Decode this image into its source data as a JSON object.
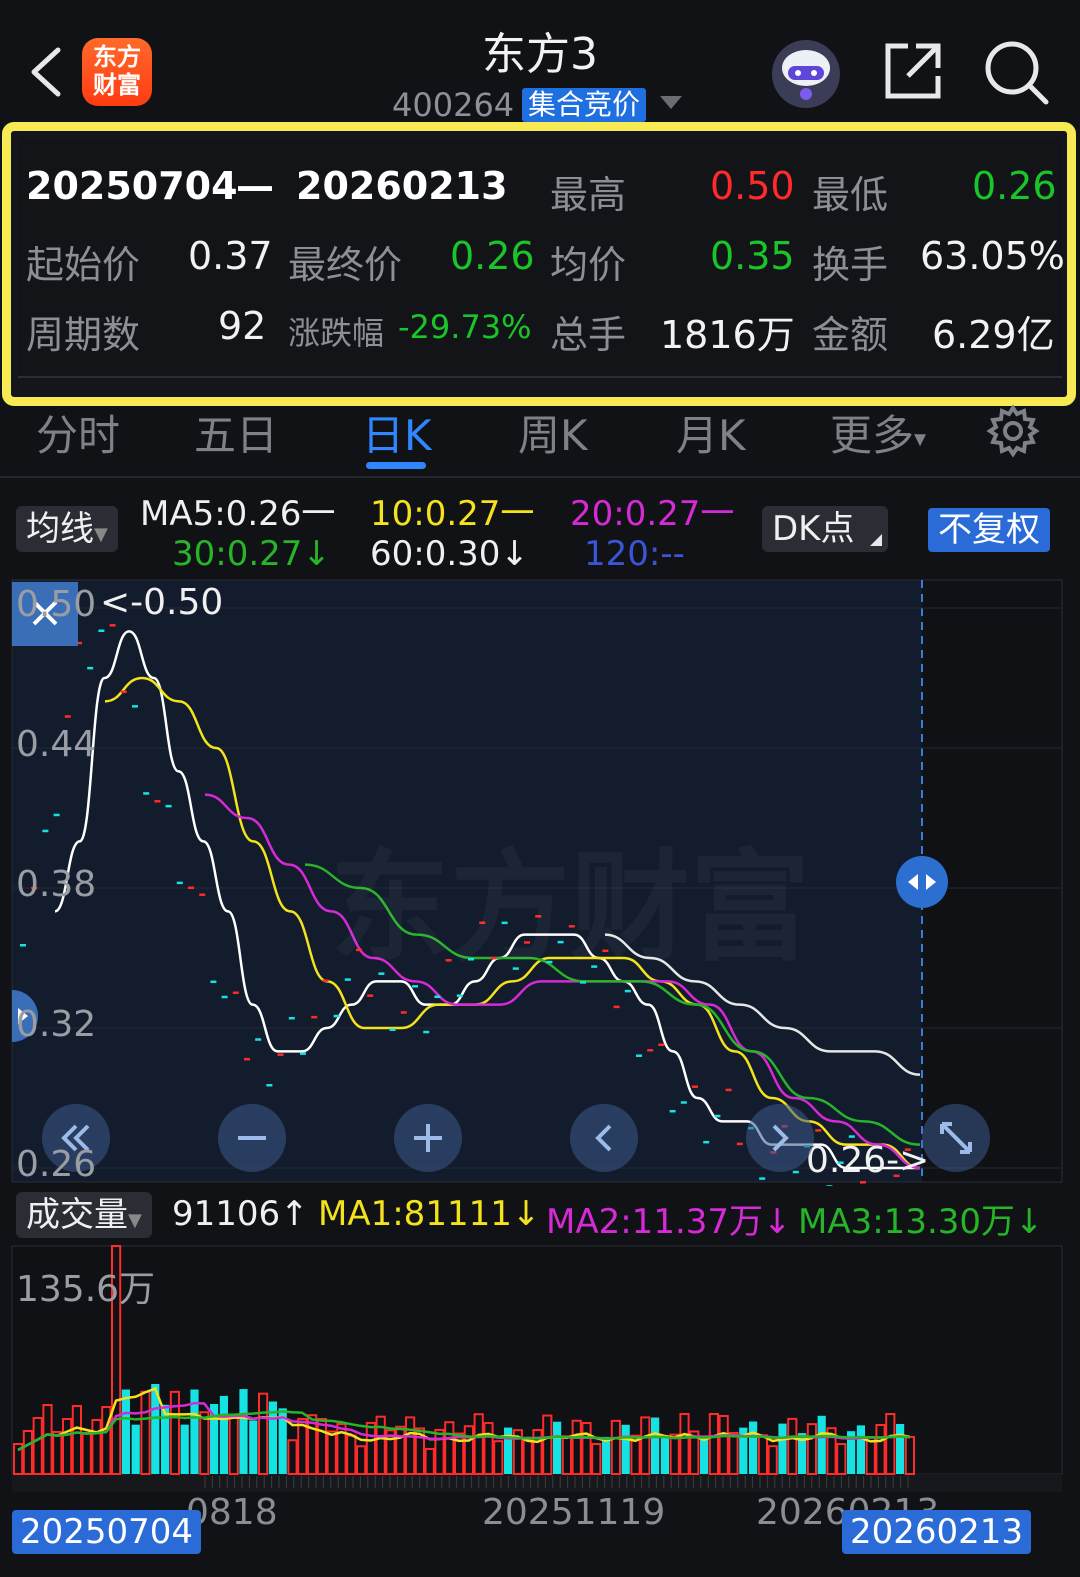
{
  "header": {
    "title": "东方3",
    "code": "400264",
    "badge": "集合竞价",
    "logo_lines": [
      "东方",
      "财富"
    ]
  },
  "stats": {
    "range_start": "20250704",
    "range_sep": "—",
    "range_end": "20260213",
    "high_label": "最高",
    "high_value": "0.50",
    "low_label": "最低",
    "low_value": "0.26",
    "open_label": "起始价",
    "open_value": "0.37",
    "close_label": "最终价",
    "close_value": "0.26",
    "avg_label": "均价",
    "avg_value": "0.35",
    "turnover_label": "换手",
    "turnover_value": "63.05%",
    "periods_label": "周期数",
    "periods_value": "92",
    "change_label": "涨跌幅",
    "change_value": "-29.73%",
    "volume_label": "总手",
    "volume_value": "1816万",
    "amount_label": "金额",
    "amount_value": "6.29亿"
  },
  "tabs": [
    "分时",
    "五日",
    "日K",
    "周K",
    "月K",
    "更多"
  ],
  "tab_more_caret": "▾",
  "ma_legend": {
    "selector": "均线",
    "ma5": "MA5:0.26一",
    "ma10": "10:0.27一",
    "ma20": "20:0.27一",
    "ma30": "30:0.27↓",
    "ma60": "60:0.30↓",
    "ma120": "120:--",
    "dk": "DK点",
    "adjust": "不复权"
  },
  "price_chart": {
    "y_ticks": [
      "0.50",
      "0.44",
      "0.38",
      "0.32",
      "0.26"
    ],
    "high_marker": "<-0.50",
    "low_marker": "0.26->",
    "watermark": "东方财富"
  },
  "volume_legend": {
    "selector": "成交量",
    "current": "91106↑",
    "ma1": "MA1:81111↓",
    "ma2": "MA2:11.37万↓",
    "ma3": "MA3:13.30万↓",
    "max_label": "135.6万"
  },
  "x_axis": {
    "labels": [
      "20250704",
      "0818",
      "20251119",
      "20260213"
    ],
    "start_badge": "20250704",
    "end_badge": "20260213",
    "overlap_label": "20260213"
  },
  "colors": {
    "up": "#ff2a2a",
    "down": "#19c528",
    "accent": "#2f86ff",
    "highlight": "#f7ea53",
    "ma5": "#ffffff",
    "ma10": "#f3e21c",
    "ma20": "#d62ad6",
    "ma30": "#28b428",
    "ma60": "#e6e6e6",
    "ma120": "#3b55d8",
    "vol_down": "#15e3e3"
  },
  "chart_data": {
    "type": "line",
    "title": "",
    "y_range": [
      0.26,
      0.5
    ],
    "series": [
      {
        "name": "MA5",
        "values": [
          0.37,
          0.4,
          0.47,
          0.49,
          0.47,
          0.43,
          0.4,
          0.37,
          0.33,
          0.31,
          0.31,
          0.32,
          0.33,
          0.34,
          0.34,
          0.33,
          0.33,
          0.34,
          0.35,
          0.36,
          0.36,
          0.36,
          0.35,
          0.34,
          0.33,
          0.31,
          0.29,
          0.28,
          0.28,
          0.27,
          0.27,
          0.27,
          0.26,
          0.26,
          0.26,
          0.26
        ]
      },
      {
        "name": "10",
        "values": [
          0.46,
          0.47,
          0.46,
          0.44,
          0.4,
          0.37,
          0.34,
          0.32,
          0.32,
          0.33,
          0.33,
          0.34,
          0.35,
          0.35,
          0.35,
          0.34,
          0.33,
          0.31,
          0.29,
          0.28,
          0.27,
          0.27,
          0.26
        ]
      },
      {
        "name": "20",
        "values": [
          0.42,
          0.41,
          0.39,
          0.37,
          0.35,
          0.34,
          0.33,
          0.33,
          0.34,
          0.34,
          0.34,
          0.34,
          0.33,
          0.31,
          0.29,
          0.28,
          0.27,
          0.26
        ]
      },
      {
        "name": "30",
        "values": [
          0.39,
          0.38,
          0.36,
          0.35,
          0.35,
          0.34,
          0.34,
          0.33,
          0.31,
          0.29,
          0.28,
          0.27
        ]
      },
      {
        "name": "60",
        "values": [
          0.36,
          0.35,
          0.34,
          0.33,
          0.32,
          0.31,
          0.31,
          0.3
        ]
      }
    ],
    "volume": {
      "max": "135.6万",
      "current": 91106,
      "ma1": 81111,
      "ma2": "11.37万",
      "ma3": "13.30万"
    }
  }
}
